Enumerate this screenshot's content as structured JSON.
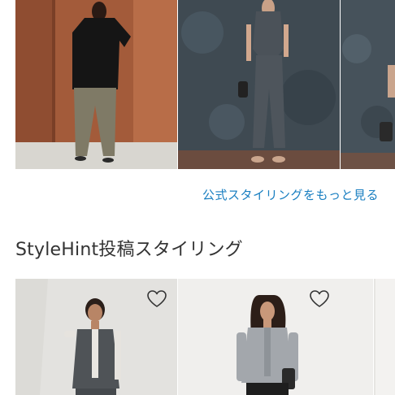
{
  "official_styling": {
    "more_link_label": "公式スタイリングをもっと見る",
    "images": [
      {
        "icon": "photo-model-black-blouse-wide-pants"
      },
      {
        "icon": "photo-model-gray-vest-pants-set"
      },
      {
        "icon": "photo-model-gray-outfit-partial"
      }
    ]
  },
  "stylehint": {
    "title": "StyleHint投稿スタイリング",
    "posts": [
      {
        "icon": "photo-model-gray-vest",
        "favorite_icon": "heart-outline-icon"
      },
      {
        "icon": "photo-model-gray-cardigan",
        "favorite_icon": "heart-outline-icon"
      },
      {
        "icon": "photo-partial"
      }
    ]
  },
  "colors": {
    "link": "#1a7fc1",
    "title": "#333333"
  }
}
